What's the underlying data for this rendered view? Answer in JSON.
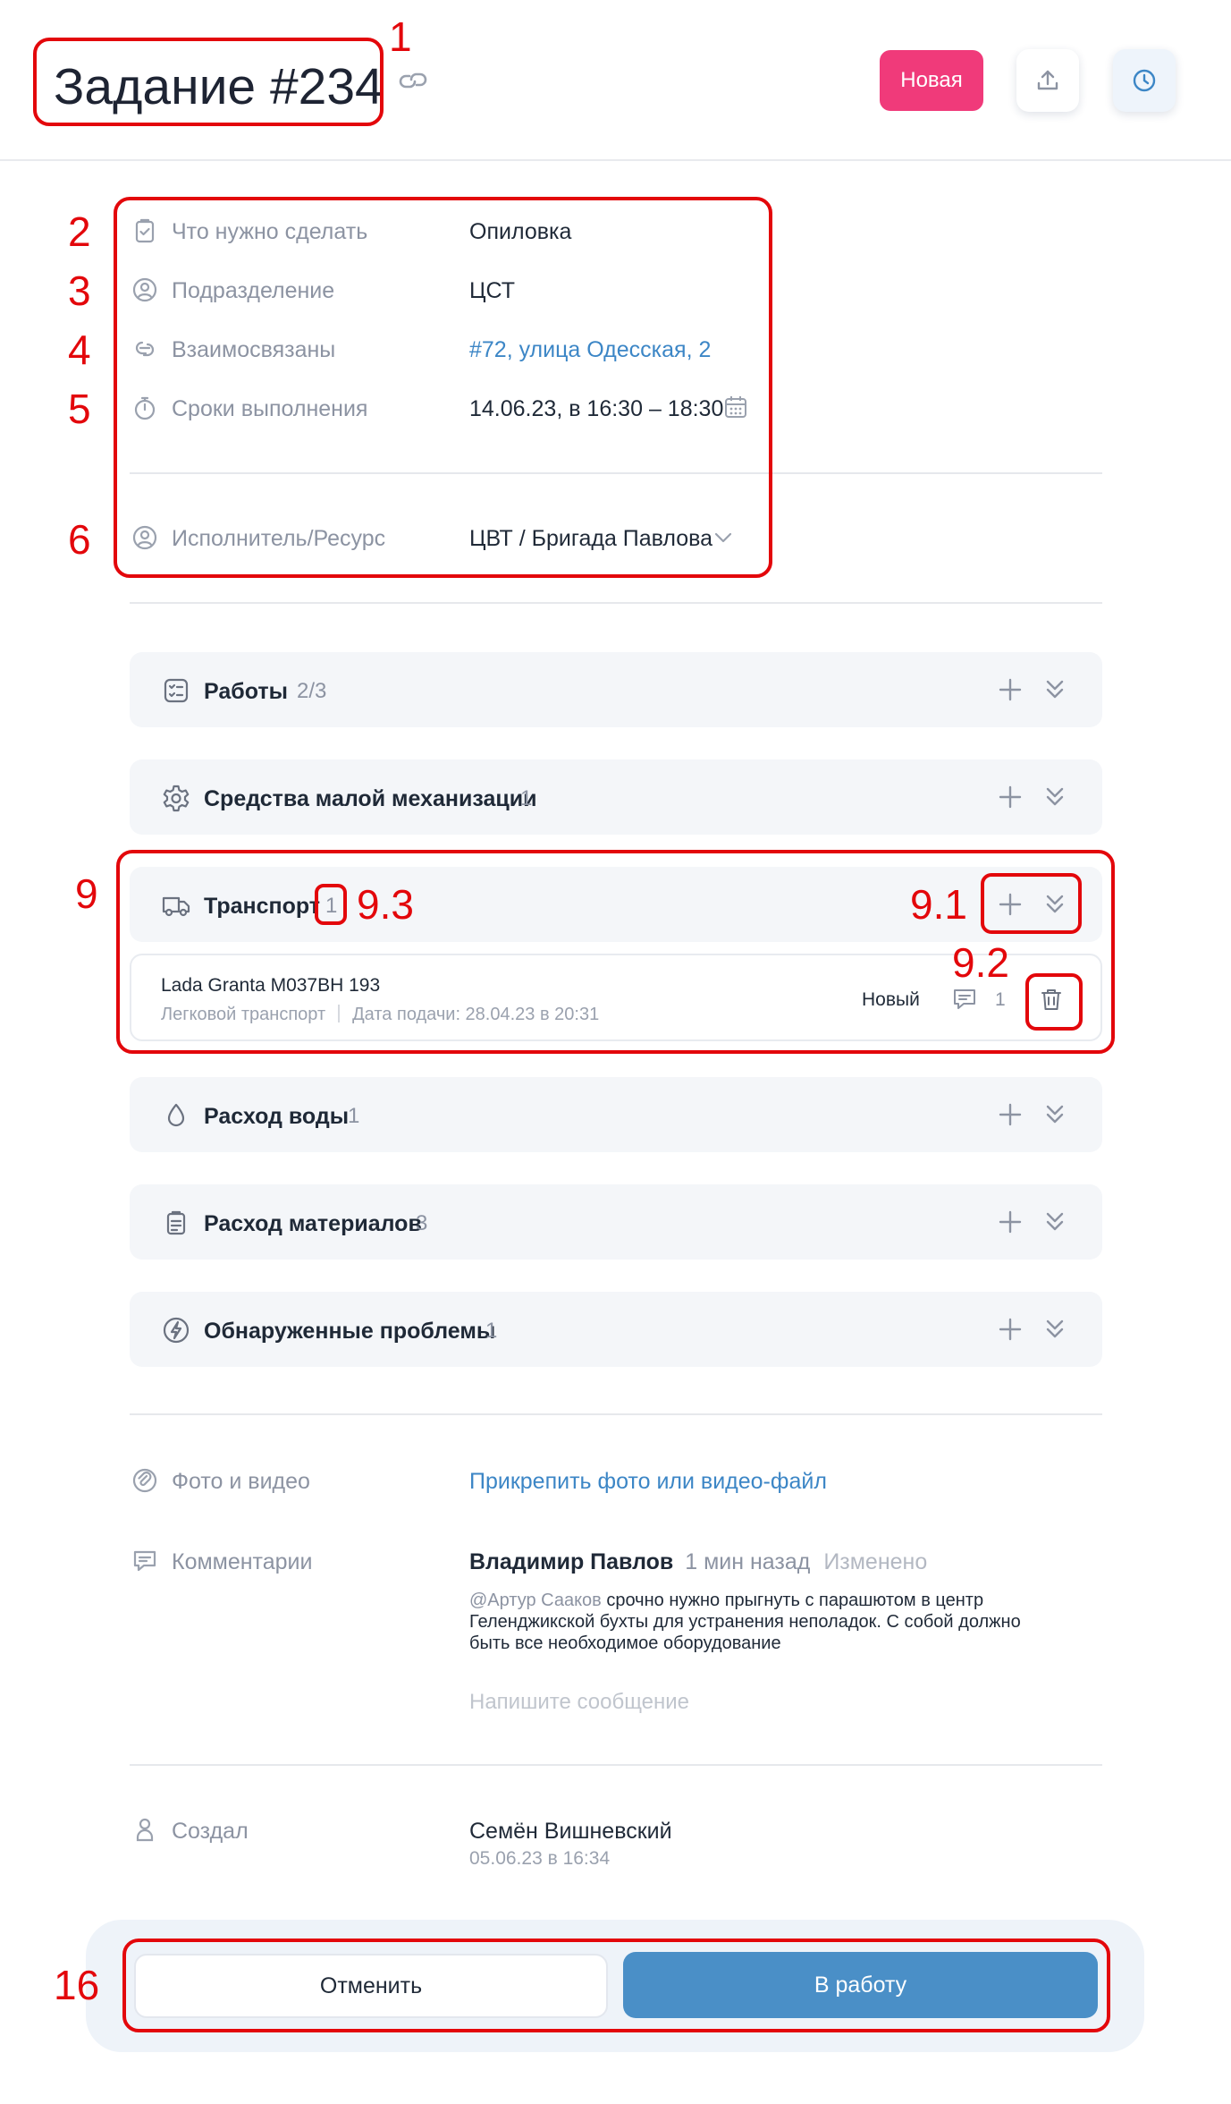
{
  "header": {
    "title": "Задание #234",
    "status_badge": "Новая",
    "icons": [
      "link-icon",
      "upload-icon",
      "clock-icon"
    ]
  },
  "info": {
    "task": {
      "label": "Что нужно сделать",
      "value": "Опиловка",
      "icon": "clipboard-check-icon"
    },
    "department": {
      "label": "Подразделение",
      "value": "ЦСТ",
      "icon": "user-circle-icon"
    },
    "related": {
      "label": "Взаимосвязаны",
      "value": "#72, улица Одесская, 2",
      "icon": "link-icon"
    },
    "deadline": {
      "label": "Сроки выполнения",
      "value": "14.06.23, в 16:30 – 18:30",
      "icon": "stopwatch-icon"
    },
    "executor": {
      "label": "Исполнитель/Ресурс",
      "value": "ЦВТ / Бригада Павлова",
      "icon": "user-circle-icon"
    }
  },
  "sections": {
    "works": {
      "title": "Работы",
      "count": "2/3",
      "icon": "checklist-icon"
    },
    "mechanization": {
      "title": "Средства малой механизации",
      "count": "1",
      "icon": "gear-icon"
    },
    "transport": {
      "title": "Транспорт",
      "count": "1",
      "icon": "truck-icon"
    },
    "water": {
      "title": "Расход воды",
      "count": "1",
      "icon": "drop-icon"
    },
    "materials": {
      "title": "Расход материалов",
      "count": "3",
      "icon": "clipboard-icon"
    },
    "problems": {
      "title": "Обнаруженные проблемы",
      "count": "1",
      "icon": "lightning-icon"
    }
  },
  "vehicle": {
    "name": "Lada Granta М037ВН 193",
    "type": "Легковой транспорт",
    "date": "Дата подачи: 28.04.23 в 20:31",
    "status": "Новый",
    "comments": "1"
  },
  "media": {
    "label": "Фото и видео",
    "action": "Прикрепить фото или видео-файл"
  },
  "comments": {
    "label": "Комментарии",
    "author": "Владимир Павлов",
    "time": "1 мин назад",
    "edited": "Изменено",
    "mention": "@Артур Сааков",
    "text_line1": " срочно нужно прыгнуть с парашютом в центр",
    "text_line2": "Геленджикской бухты для устранения неполадок. С собой должно",
    "text_line3": "быть все необходимое оборудование",
    "placeholder": "Напишите сообщение"
  },
  "created": {
    "label": "Создал",
    "name": "Семён Вишневский",
    "date": "05.06.23 в 16:34"
  },
  "actions": {
    "cancel": "Отменить",
    "start": "В работу"
  },
  "annotations": {
    "n1": "1",
    "n2": "2",
    "n3": "3",
    "n4": "4",
    "n5": "5",
    "n6": "6",
    "n9": "9",
    "n91": "9.1",
    "n92": "9.2",
    "n93": "9.3",
    "n16": "16",
    "color": "#e3070b"
  }
}
